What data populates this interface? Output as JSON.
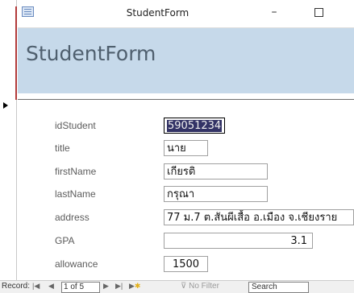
{
  "window": {
    "title": "StudentForm",
    "min_glyph": "–",
    "close_glyph": "×"
  },
  "form": {
    "header_title": "StudentForm"
  },
  "fields": {
    "idStudent": {
      "label": "idStudent",
      "value": "59051234"
    },
    "title": {
      "label": "title",
      "value": "นาย"
    },
    "firstName": {
      "label": "firstName",
      "value": "เกียรติ"
    },
    "lastName": {
      "label": "lastName",
      "value": "กรุณา"
    },
    "address": {
      "label": "address",
      "value": "77 ม.7 ต.สันผีเสื้อ อ.เมือง จ.เชียงราย"
    },
    "GPA": {
      "label": "GPA",
      "value": "3.1"
    },
    "allowance": {
      "label": "allowance",
      "value": "1500"
    }
  },
  "navigation": {
    "record_label": "Record:",
    "first_glyph": "|◀",
    "prev_glyph": "◀",
    "position": "1 of 5",
    "next_glyph": "▶",
    "last_glyph": "▶|",
    "new_glyph": "▶",
    "filter_label": "No Filter",
    "search_label": "Search"
  },
  "colors": {
    "header_band": "#c6d9ea",
    "selection": "#333366"
  }
}
